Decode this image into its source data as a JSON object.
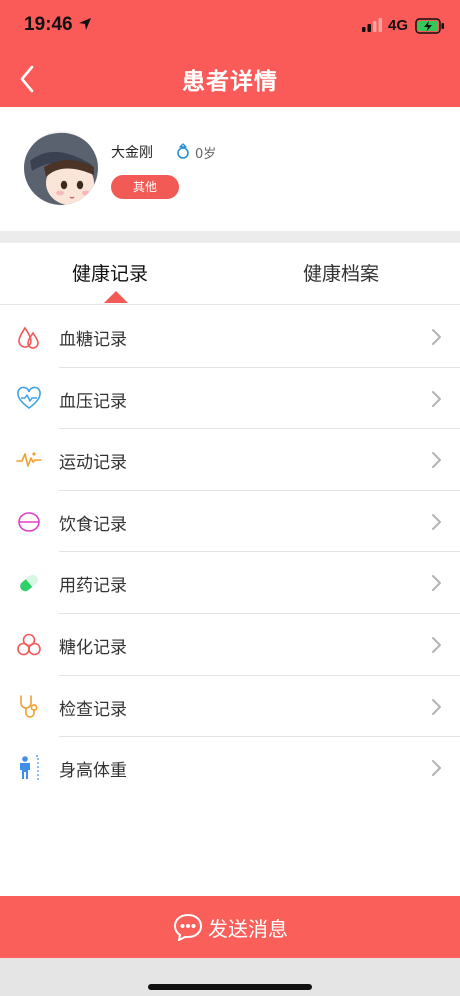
{
  "status_bar": {
    "time": "19:46",
    "network": "4G"
  },
  "nav": {
    "title": "患者详情"
  },
  "profile": {
    "name": "大金刚",
    "age": "0岁",
    "tag": "其他"
  },
  "tabs": [
    {
      "label": "健康记录",
      "active": true
    },
    {
      "label": "健康档案",
      "active": false
    }
  ],
  "records": [
    {
      "label": "血糖记录",
      "icon": "blood-drop-icon",
      "color": "#f25a5a"
    },
    {
      "label": "血压记录",
      "icon": "heart-pulse-icon",
      "color": "#3fa3e8"
    },
    {
      "label": "运动记录",
      "icon": "activity-wave-icon",
      "color": "#f0a030"
    },
    {
      "label": "饮食记录",
      "icon": "bowl-icon",
      "color": "#e040c8"
    },
    {
      "label": "用药记录",
      "icon": "pill-icon",
      "color": "#2fcf6a"
    },
    {
      "label": "糖化记录",
      "icon": "molecule-icon",
      "color": "#f25a5a"
    },
    {
      "label": "检查记录",
      "icon": "stethoscope-icon",
      "color": "#f0a030"
    },
    {
      "label": "身高体重",
      "icon": "person-height-icon",
      "color": "#3f8ee8"
    }
  ],
  "send": {
    "label": "发送消息"
  },
  "colors": {
    "brand": "#fb5b58",
    "tag": "#f15a55"
  }
}
